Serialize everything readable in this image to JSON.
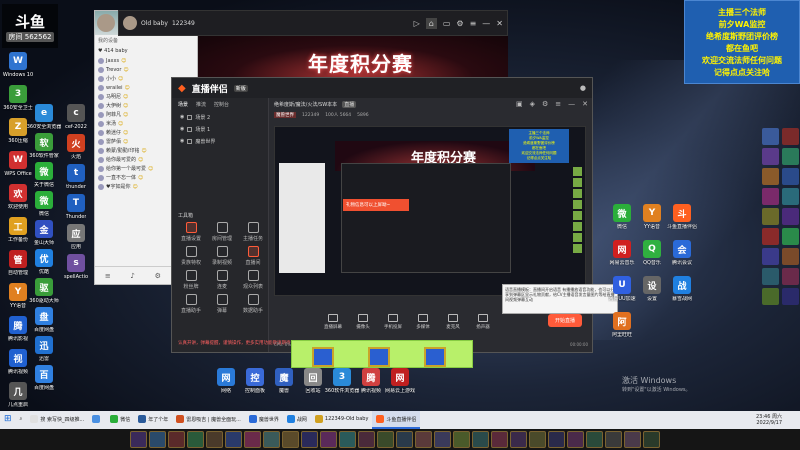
{
  "logo": {
    "line1": "斗鱼",
    "line2": "房间",
    "line3": "562562"
  },
  "info_box": {
    "lines": [
      "主播三个法师",
      "前夕WA监控",
      "绝希度斯野团评价榜",
      "都在鱼吧",
      "欢迎交流法师任何问题",
      "记得点点关注哈"
    ]
  },
  "top_window": {
    "title": "Old baby",
    "room": "122349"
  },
  "banner": {
    "text": "年度积分赛"
  },
  "qq": {
    "section": "我的设备",
    "group": "♥ 414 baby",
    "contacts": [
      "Jaxxs",
      "Trevor",
      "小小",
      "wrailei",
      "马明尼",
      "大伊树",
      "阿菲凡",
      "米汤",
      "赖迷仔",
      "雷萨佰",
      "赖蒙/勤勤/印铭",
      "给你最可爱的",
      "给你第一个最可爱",
      "一直不忘一体",
      "♥宇如是你"
    ]
  },
  "live": {
    "brand": "直播伴侣",
    "version": "新版",
    "tabs": [
      "场景",
      "推流",
      "控制台"
    ],
    "scenes": [
      "场景 2",
      "场景 1",
      "魔兽世界"
    ],
    "tools_title": "工具箱",
    "tools": [
      "直播设置",
      "房间管理",
      "主播任务",
      "贵族特权",
      "录制视频",
      "直播间",
      "粉丝牌",
      "连麦",
      "观众列表",
      "直播助手",
      "弹幕",
      "数据助手"
    ],
    "notice": "认真开讲，弹幕提醒，谨慎操作，更多实用功能敬请期待",
    "room_title": "绝希度斯/魔法/火法/SW本本",
    "room_tag": "直播",
    "info_tags": [
      "魔兽世界",
      "122349",
      "100人 5664",
      "5896"
    ],
    "popup": "礼物信息可以上屏呦~",
    "tooltip": "语音直播模板：直播间开启语音  有播播放语音功能，也可以分享到弹幕区显示礼物贡献，给CV主播语音发言量图片等给直播间视频弹幕互动",
    "bottom_buttons": [
      "直播屏幕",
      "摄像头",
      "手机投屏",
      "多媒体",
      "麦克风",
      "扬声器"
    ],
    "start_button": "开始直播",
    "stats": [
      "CPU: 0%",
      "内存: 0",
      "帧率: 0",
      "丢帧: 0",
      "00:00:00"
    ]
  },
  "desktop_left": [
    {
      "label": "Windows 10",
      "color": "#2f74d0",
      "g": "W"
    },
    {
      "label": "360安全卫士",
      "color": "#3a9d3a",
      "g": "3"
    },
    {
      "label": "360压缩",
      "color": "#d8a02a",
      "g": "Z"
    },
    {
      "label": "WPS Office",
      "color": "#d03030",
      "g": "W"
    },
    {
      "label": "欢迎使用",
      "color": "#d03030",
      "g": "欢"
    },
    {
      "label": "工作备份",
      "color": "#e0a020",
      "g": "工"
    },
    {
      "label": "自动管理",
      "color": "#c02020",
      "g": "管"
    },
    {
      "label": "YY语音",
      "color": "#e08020",
      "g": "Y"
    },
    {
      "label": "腾讯影视",
      "color": "#2060d0",
      "g": "腾"
    },
    {
      "label": "腾讯视频",
      "color": "#2060d0",
      "g": "视"
    },
    {
      "label": "几点重启",
      "color": "#555",
      "g": "几"
    }
  ],
  "desktop_col2": [
    {
      "label": "360安全浏览器",
      "color": "#2a8ad8",
      "g": "e"
    },
    {
      "label": "360软件管家",
      "color": "#3a9d3a",
      "g": "软"
    },
    {
      "label": "关于微信",
      "color": "#2bae3a",
      "g": "微"
    },
    {
      "label": "微信",
      "color": "#2bae3a",
      "g": "微"
    },
    {
      "label": "金山大师",
      "color": "#3050c0",
      "g": "金"
    },
    {
      "label": "优酷",
      "color": "#2080e0",
      "g": "优"
    },
    {
      "label": "360驱动大师",
      "color": "#3a9d3a",
      "g": "驱"
    },
    {
      "label": "百度网盘",
      "color": "#3080e0",
      "g": "盘"
    },
    {
      "label": "迅雷",
      "color": "#2070d0",
      "g": "迅"
    },
    {
      "label": "百度网盘",
      "color": "#3080e0",
      "g": "百"
    }
  ],
  "desktop_col3": [
    {
      "label": "cef-2022",
      "color": "#555",
      "g": "c"
    },
    {
      "label": "火焰",
      "color": "#d04020",
      "g": "火"
    },
    {
      "label": "thunder",
      "color": "#2060c0",
      "g": "t"
    },
    {
      "label": "Thunder",
      "color": "#2060c0",
      "g": "T"
    },
    {
      "label": "应用",
      "color": "#777",
      "g": "应"
    },
    {
      "label": "spellActio",
      "color": "#7050a0",
      "g": "s"
    }
  ],
  "desktop_bottom": [
    {
      "label": "网络",
      "color": "#2a7ad8",
      "g": "网"
    },
    {
      "label": "控制面板",
      "color": "#3a6ad8",
      "g": "控"
    },
    {
      "label": "魔兽",
      "color": "#3060c0",
      "g": "魔"
    },
    {
      "label": "回收站",
      "color": "#888",
      "g": "回"
    },
    {
      "label": "360软件浏览器",
      "color": "#2a8ad8",
      "g": "3"
    },
    {
      "label": "腾讯视频",
      "color": "#d04040",
      "g": "腾"
    },
    {
      "label": "网易云上游戏",
      "color": "#c02020",
      "g": "网"
    }
  ],
  "desktop_right": [
    {
      "label": "微信",
      "color": "#2bae3a",
      "g": "微"
    },
    {
      "label": "YY语音",
      "color": "#e08020",
      "g": "Y"
    },
    {
      "label": "斗鱼直播伴侣",
      "color": "#ff6020",
      "g": "斗"
    },
    {
      "label": "网易云音乐",
      "color": "#d02020",
      "g": "网"
    },
    {
      "label": "QQ音乐",
      "color": "#30b040",
      "g": "Q"
    },
    {
      "label": "腾讯会议",
      "color": "#2a6ad8",
      "g": "会"
    },
    {
      "label": "网易UU加速",
      "color": "#3060e0",
      "g": "U"
    },
    {
      "label": "设置",
      "color": "#666",
      "g": "设"
    },
    {
      "label": "暴雪战网",
      "color": "#2080e0",
      "g": "战"
    },
    {
      "label": "阿里旺旺",
      "color": "#e07020",
      "g": "阿"
    }
  ],
  "win_activation": {
    "line1": "激活 Windows",
    "line2": "转到\"设置\"以激活 Windows。"
  },
  "taskbar": {
    "items": [
      {
        "label": "搜 索写快_四级推...",
        "color": "#e0e0e0"
      },
      {
        "label": "",
        "color": "#4a90e2"
      },
      {
        "label": "微信",
        "color": "#2bae3a"
      },
      {
        "label": "年了个年",
        "color": "#2a5a9a"
      },
      {
        "label": "雷恩吸吉 | 魔兽全面玩...",
        "color": "#d05020"
      },
      {
        "label": "魔兽世界",
        "color": "#2a6ad8"
      },
      {
        "label": "战网",
        "color": "#2080e0"
      },
      {
        "label": "122349-Old baby",
        "color": "#d0a020"
      },
      {
        "label": "斗鱼直播伴侣",
        "color": "#ff6020"
      }
    ],
    "time": "23:46 周六",
    "date": "2022/9/17"
  }
}
